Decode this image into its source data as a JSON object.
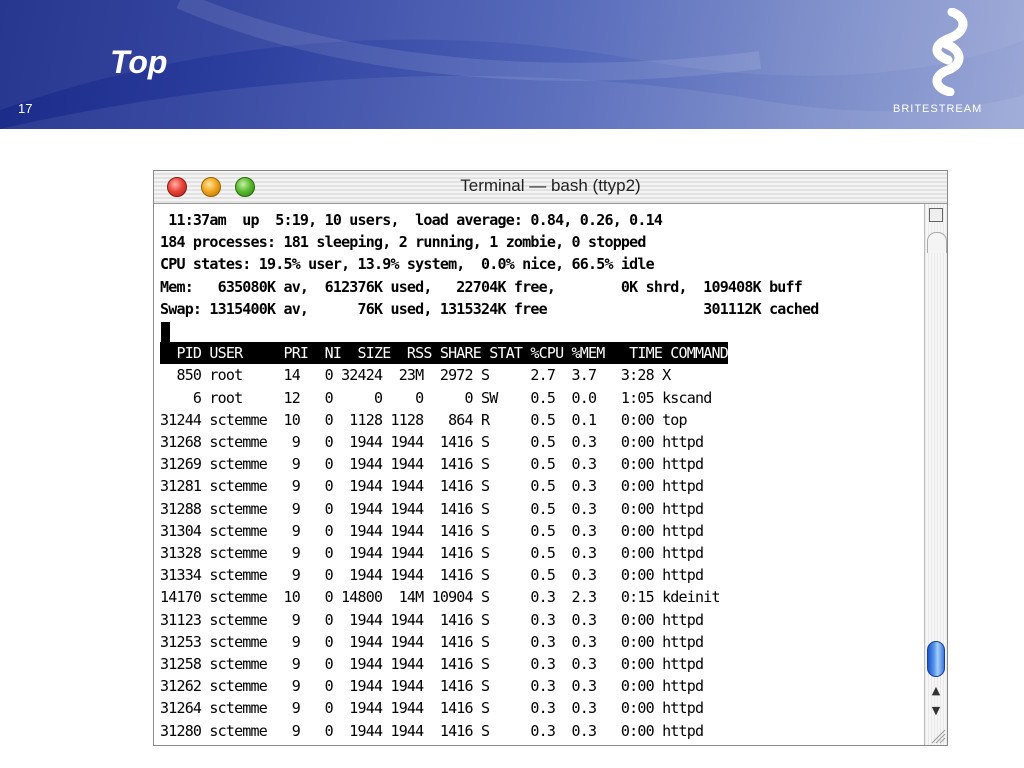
{
  "slide": {
    "title": "Top",
    "number": "17",
    "logo_text": "BRITESTREAM"
  },
  "window": {
    "title": "Terminal — bash (ttyp2)"
  },
  "terminal": {
    "status_lines": [
      " 11:37am  up  5:19, 10 users,  load average: 0.84, 0.26, 0.14",
      "184 processes: 181 sleeping, 2 running, 1 zombie, 0 stopped",
      "CPU states: 19.5% user, 13.9% system,  0.0% nice, 66.5% idle",
      "Mem:   635080K av,  612376K used,   22704K free,        0K shrd,  109408K buff",
      "Swap: 1315400K av,      76K used, 1315324K free                   301112K cached"
    ],
    "header": "  PID USER     PRI  NI  SIZE  RSS SHARE STAT %CPU %MEM   TIME COMMAND",
    "columns": [
      "PID",
      "USER",
      "PRI",
      "NI",
      "SIZE",
      "RSS",
      "SHARE",
      "STAT",
      "%CPU",
      "%MEM",
      "TIME",
      "COMMAND"
    ],
    "processes": [
      [
        "850",
        "root",
        "14",
        "0",
        "32424",
        "23M",
        "2972",
        "S",
        "2.7",
        "3.7",
        "3:28",
        "X"
      ],
      [
        "6",
        "root",
        "12",
        "0",
        "0",
        "0",
        "0",
        "SW",
        "0.5",
        "0.0",
        "1:05",
        "kscand"
      ],
      [
        "31244",
        "sctemme",
        "10",
        "0",
        "1128",
        "1128",
        "864",
        "R",
        "0.5",
        "0.1",
        "0:00",
        "top"
      ],
      [
        "31268",
        "sctemme",
        "9",
        "0",
        "1944",
        "1944",
        "1416",
        "S",
        "0.5",
        "0.3",
        "0:00",
        "httpd"
      ],
      [
        "31269",
        "sctemme",
        "9",
        "0",
        "1944",
        "1944",
        "1416",
        "S",
        "0.5",
        "0.3",
        "0:00",
        "httpd"
      ],
      [
        "31281",
        "sctemme",
        "9",
        "0",
        "1944",
        "1944",
        "1416",
        "S",
        "0.5",
        "0.3",
        "0:00",
        "httpd"
      ],
      [
        "31288",
        "sctemme",
        "9",
        "0",
        "1944",
        "1944",
        "1416",
        "S",
        "0.5",
        "0.3",
        "0:00",
        "httpd"
      ],
      [
        "31304",
        "sctemme",
        "9",
        "0",
        "1944",
        "1944",
        "1416",
        "S",
        "0.5",
        "0.3",
        "0:00",
        "httpd"
      ],
      [
        "31328",
        "sctemme",
        "9",
        "0",
        "1944",
        "1944",
        "1416",
        "S",
        "0.5",
        "0.3",
        "0:00",
        "httpd"
      ],
      [
        "31334",
        "sctemme",
        "9",
        "0",
        "1944",
        "1944",
        "1416",
        "S",
        "0.5",
        "0.3",
        "0:00",
        "httpd"
      ],
      [
        "14170",
        "sctemme",
        "10",
        "0",
        "14800",
        "14M",
        "10904",
        "S",
        "0.3",
        "2.3",
        "0:15",
        "kdeinit"
      ],
      [
        "31123",
        "sctemme",
        "9",
        "0",
        "1944",
        "1944",
        "1416",
        "S",
        "0.3",
        "0.3",
        "0:00",
        "httpd"
      ],
      [
        "31253",
        "sctemme",
        "9",
        "0",
        "1944",
        "1944",
        "1416",
        "S",
        "0.3",
        "0.3",
        "0:00",
        "httpd"
      ],
      [
        "31258",
        "sctemme",
        "9",
        "0",
        "1944",
        "1944",
        "1416",
        "S",
        "0.3",
        "0.3",
        "0:00",
        "httpd"
      ],
      [
        "31262",
        "sctemme",
        "9",
        "0",
        "1944",
        "1944",
        "1416",
        "S",
        "0.3",
        "0.3",
        "0:00",
        "httpd"
      ],
      [
        "31264",
        "sctemme",
        "9",
        "0",
        "1944",
        "1944",
        "1416",
        "S",
        "0.3",
        "0.3",
        "0:00",
        "httpd"
      ],
      [
        "31280",
        "sctemme",
        "9",
        "0",
        "1944",
        "1944",
        "1416",
        "S",
        "0.3",
        "0.3",
        "0:00",
        "httpd"
      ]
    ]
  },
  "icons": {
    "close": "close-button-icon",
    "minimize": "minimize-button-icon",
    "zoom": "zoom-button-icon",
    "split": "split-pane-icon",
    "scroll_up": "▲",
    "scroll_down": "▼",
    "logo": "britestream-logo-icon"
  },
  "colors": {
    "header_gradient_start": "#1a2a88",
    "header_gradient_end": "#9aa7d6",
    "close": "#e8463a",
    "minimize": "#f0a820",
    "zoom": "#5cbc30",
    "scroll_thumb": "#3a78e0"
  }
}
